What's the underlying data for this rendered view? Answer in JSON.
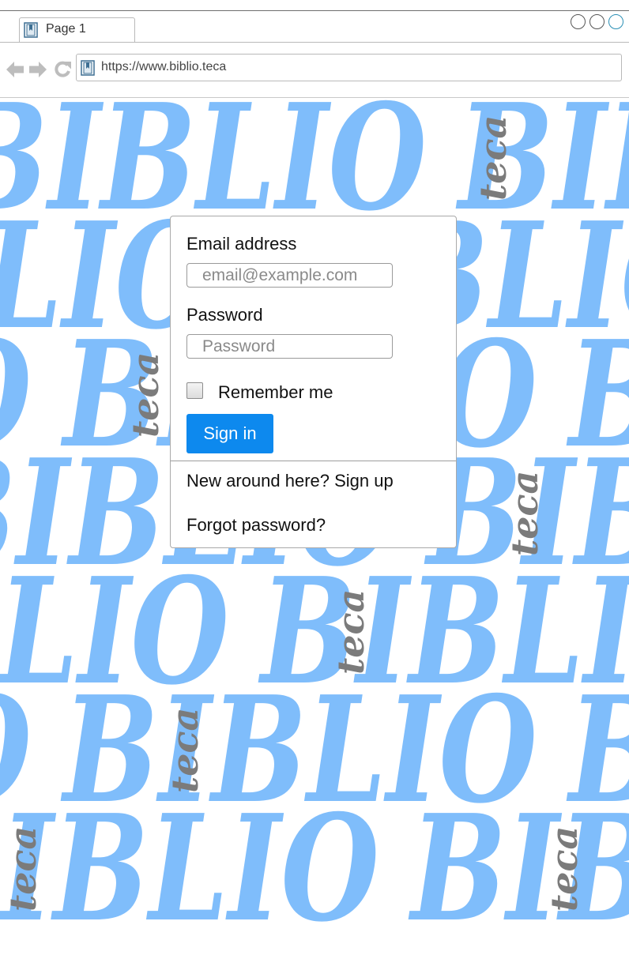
{
  "browser": {
    "tab_label": "Page 1",
    "url": "https://www.biblio.teca",
    "icons": {
      "tab": "bookmark-page-icon",
      "url": "bookmark-page-icon",
      "back": "arrow-left-icon",
      "forward": "arrow-right-icon",
      "reload": "reload-icon"
    }
  },
  "background": {
    "word_main": "BIBLIO",
    "word_side": "teca",
    "main_color": "#7fbdfb",
    "side_color": "#7b7b7b"
  },
  "login": {
    "email_label": "Email address",
    "email_placeholder": "email@example.com",
    "password_label": "Password",
    "password_placeholder": "Password",
    "remember_label": "Remember me",
    "signin_label": "Sign in",
    "signup_link": "New around here? Sign up",
    "forgot_link": "Forgot password?",
    "accent_color": "#0d89ee"
  }
}
